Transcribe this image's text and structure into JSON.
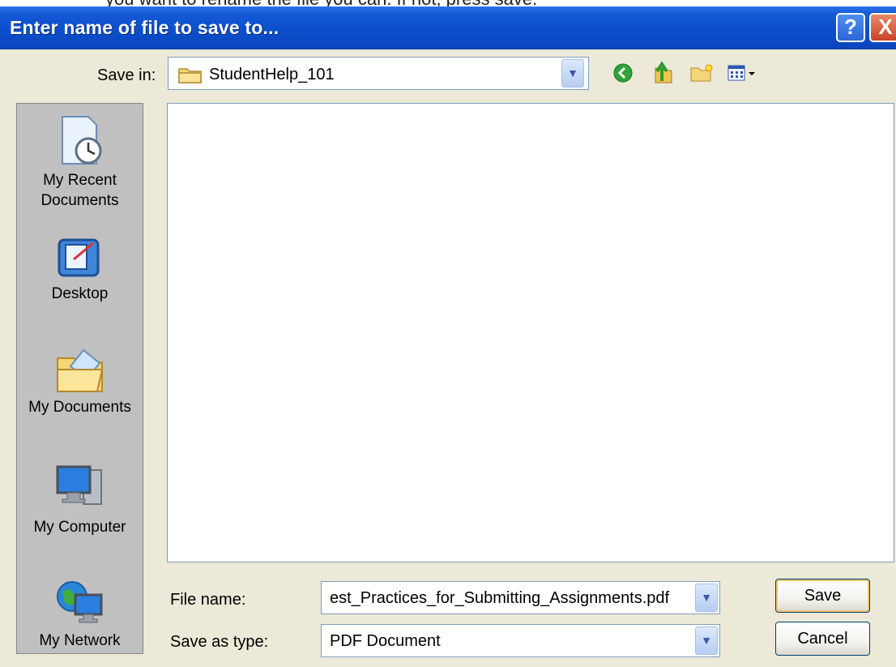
{
  "instruction_fragment": "you want to rename the file you can. If not, press save.",
  "window": {
    "title": "Enter name of file to save to...",
    "help_glyph": "?",
    "close_glyph": "X"
  },
  "save_in": {
    "label": "Save in:",
    "value": "StudentHelp_101"
  },
  "toolbar": {
    "icons": [
      "back-icon",
      "up-one-level-icon",
      "new-folder-icon",
      "views-menu-icon"
    ]
  },
  "places": [
    {
      "label": "My Recent Documents",
      "line1": "My Recent",
      "line2": "Documents",
      "icon": "recent-documents-icon"
    },
    {
      "label": "Desktop",
      "icon": "desktop-icon"
    },
    {
      "label": "My Documents",
      "icon": "my-documents-icon"
    },
    {
      "label": "My Computer",
      "icon": "my-computer-icon"
    },
    {
      "label": "My Network",
      "icon": "my-network-icon"
    }
  ],
  "file_name": {
    "label": "File name:",
    "value": "est_Practices_for_Submitting_Assignments.pdf"
  },
  "save_as_type": {
    "label": "Save as type:",
    "value": "PDF Document"
  },
  "buttons": {
    "save": "Save",
    "cancel": "Cancel"
  },
  "colors": {
    "titlebar": "#0c4fcc",
    "dialog_bg": "#ece9d8",
    "places_bg": "#c0c0c0"
  }
}
